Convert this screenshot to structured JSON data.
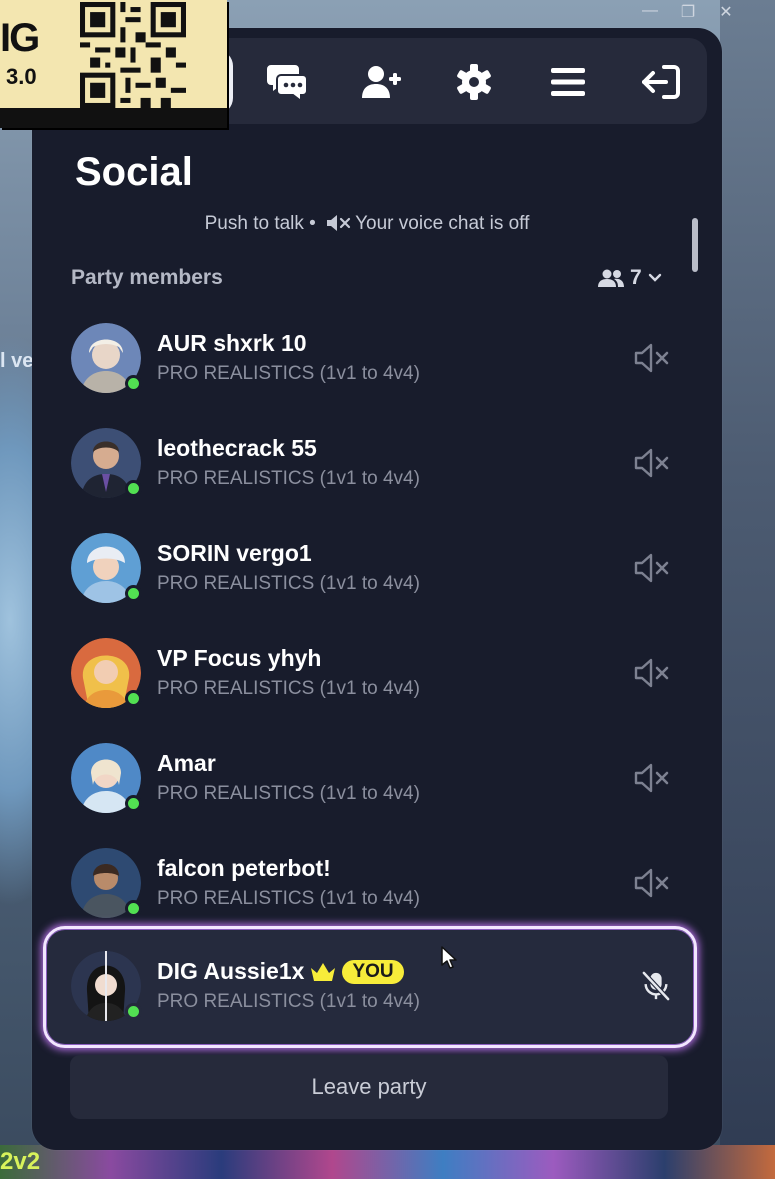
{
  "overlay": {
    "mark": "IG",
    "version": "3.0"
  },
  "window_controls": [
    "minimize",
    "restore",
    "close"
  ],
  "background": {
    "snippet": "l ve",
    "bottom_text": "2v2"
  },
  "tabs": [
    {
      "icon": "chat-icon",
      "active": false
    },
    {
      "icon": "add-friend-icon",
      "active": false
    },
    {
      "icon": "gear-icon",
      "active": false
    },
    {
      "icon": "menu-icon",
      "active": false
    },
    {
      "icon": "exit-icon",
      "active": false
    }
  ],
  "social": {
    "title": "Social",
    "voice_prefix": "Push to talk •",
    "voice_status": "Your voice chat is off"
  },
  "party": {
    "header": "Party members",
    "count": "7",
    "members": [
      {
        "name": "AUR shxrk 10",
        "status": "PRO REALISTICS (1v1 to 4v4)",
        "online": true,
        "avatar_color": "#6d87b8"
      },
      {
        "name": "leothecrack 55",
        "status": "PRO REALISTICS (1v1 to 4v4)",
        "online": true,
        "avatar_color": "#3d4f75"
      },
      {
        "name": "SORIN vergo1",
        "status": "PRO REALISTICS (1v1 to 4v4)",
        "online": true,
        "avatar_color": "#5f9fd4"
      },
      {
        "name": "VP Focus yhyh",
        "status": "PRO REALISTICS (1v1 to 4v4)",
        "online": true,
        "avatar_color": "#d96a3f"
      },
      {
        "name": "Amar",
        "status": "PRO REALISTICS (1v1 to 4v4)",
        "online": true,
        "avatar_color": "#4f89c7"
      },
      {
        "name": "falcon peterbot!",
        "status": "PRO REALISTICS (1v1 to 4v4)",
        "online": true,
        "avatar_color": "#2e4a72"
      }
    ],
    "self": {
      "name": "DIG Aussie1x",
      "badge": "YOU",
      "status": "PRO REALISTICS (1v1 to 4v4)",
      "online": true,
      "avatar_color": "#2c3550"
    },
    "leave_label": "Leave party"
  },
  "colors": {
    "panel": "#181c2c",
    "online": "#52e052",
    "you_badge": "#f7ec3a",
    "highlight_border": "#f2e6ff"
  }
}
